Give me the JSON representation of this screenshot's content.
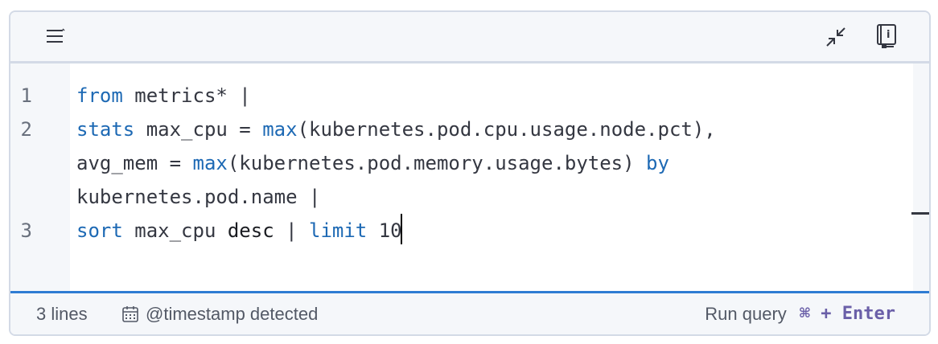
{
  "toolbar": {
    "left_icon": "list-lines-icon",
    "right_icons": [
      "minimize-icon",
      "documentation-icon"
    ]
  },
  "editor": {
    "line_numbers": [
      "1",
      "2",
      "3"
    ],
    "lines": [
      [
        {
          "t": "from",
          "c": "kw"
        },
        {
          "t": " metrics* |",
          "c": "plain"
        }
      ],
      [
        {
          "t": "stats",
          "c": "kw"
        },
        {
          "t": " max_cpu = ",
          "c": "plain"
        },
        {
          "t": "max",
          "c": "fn"
        },
        {
          "t": "(kubernetes.pod.cpu.usage.node.pct),",
          "c": "plain"
        }
      ],
      [
        {
          "t": "avg_mem = ",
          "c": "plain"
        },
        {
          "t": "max",
          "c": "fn"
        },
        {
          "t": "(kubernetes.pod.memory.usage.bytes) ",
          "c": "plain"
        },
        {
          "t": "by",
          "c": "kw"
        }
      ],
      [
        {
          "t": "kubernetes.pod.name |",
          "c": "plain"
        }
      ],
      [
        {
          "t": "sort",
          "c": "kw"
        },
        {
          "t": " max_cpu ",
          "c": "plain"
        },
        {
          "t": "desc",
          "c": "dark"
        },
        {
          "t": " | ",
          "c": "plain"
        },
        {
          "t": "limit",
          "c": "kw"
        },
        {
          "t": " 10",
          "c": "plain"
        }
      ]
    ]
  },
  "footer": {
    "line_count": "3 lines",
    "timestamp_label": "@timestamp detected",
    "run_label": "Run query",
    "shortcut": "⌘ + Enter"
  },
  "colors": {
    "keyword": "#1d69b4",
    "text": "#343741",
    "accent_border": "#2f7cd3",
    "shortcut": "#6a5fa8"
  }
}
